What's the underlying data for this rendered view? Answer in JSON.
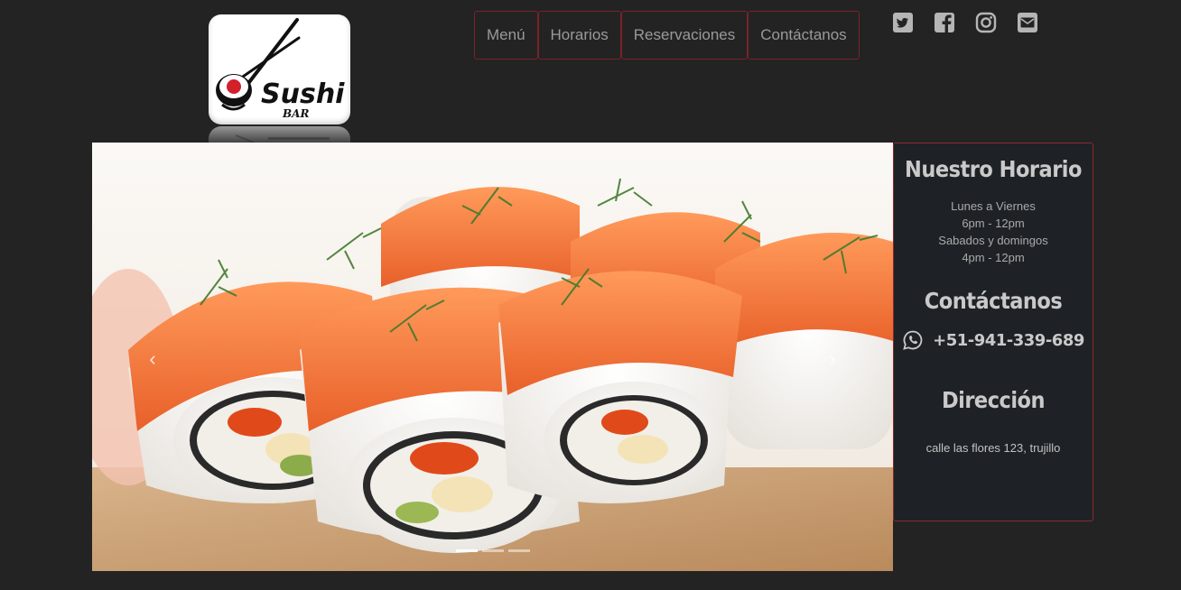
{
  "brand": {
    "logo_word": "Sushi",
    "logo_sub": "BAR"
  },
  "nav": {
    "items": [
      "Menú",
      "Horarios",
      "Reservaciones",
      "Contáctanos"
    ]
  },
  "social": [
    "twitter-icon",
    "facebook-icon",
    "instagram-icon",
    "envelope-icon"
  ],
  "carousel": {
    "slide_count": 3,
    "active_index": 0,
    "prev_symbol": "‹",
    "next_symbol": "›"
  },
  "info": {
    "hours_title": "Nuestro Horario",
    "weekday_label": "Lunes a Viernes",
    "weekday_hours": "6pm - 12pm",
    "weekend_label": "Sabados y domingos",
    "weekend_hours": "4pm - 12pm",
    "contact_title": "Contáctanos",
    "phone": "+51-941-339-689",
    "address_title": "Dirección",
    "address": "calle las flores 123, trujillo"
  },
  "colors": {
    "background": "#232323",
    "accent_border": "#8a2a30",
    "panel": "#1e2226"
  }
}
